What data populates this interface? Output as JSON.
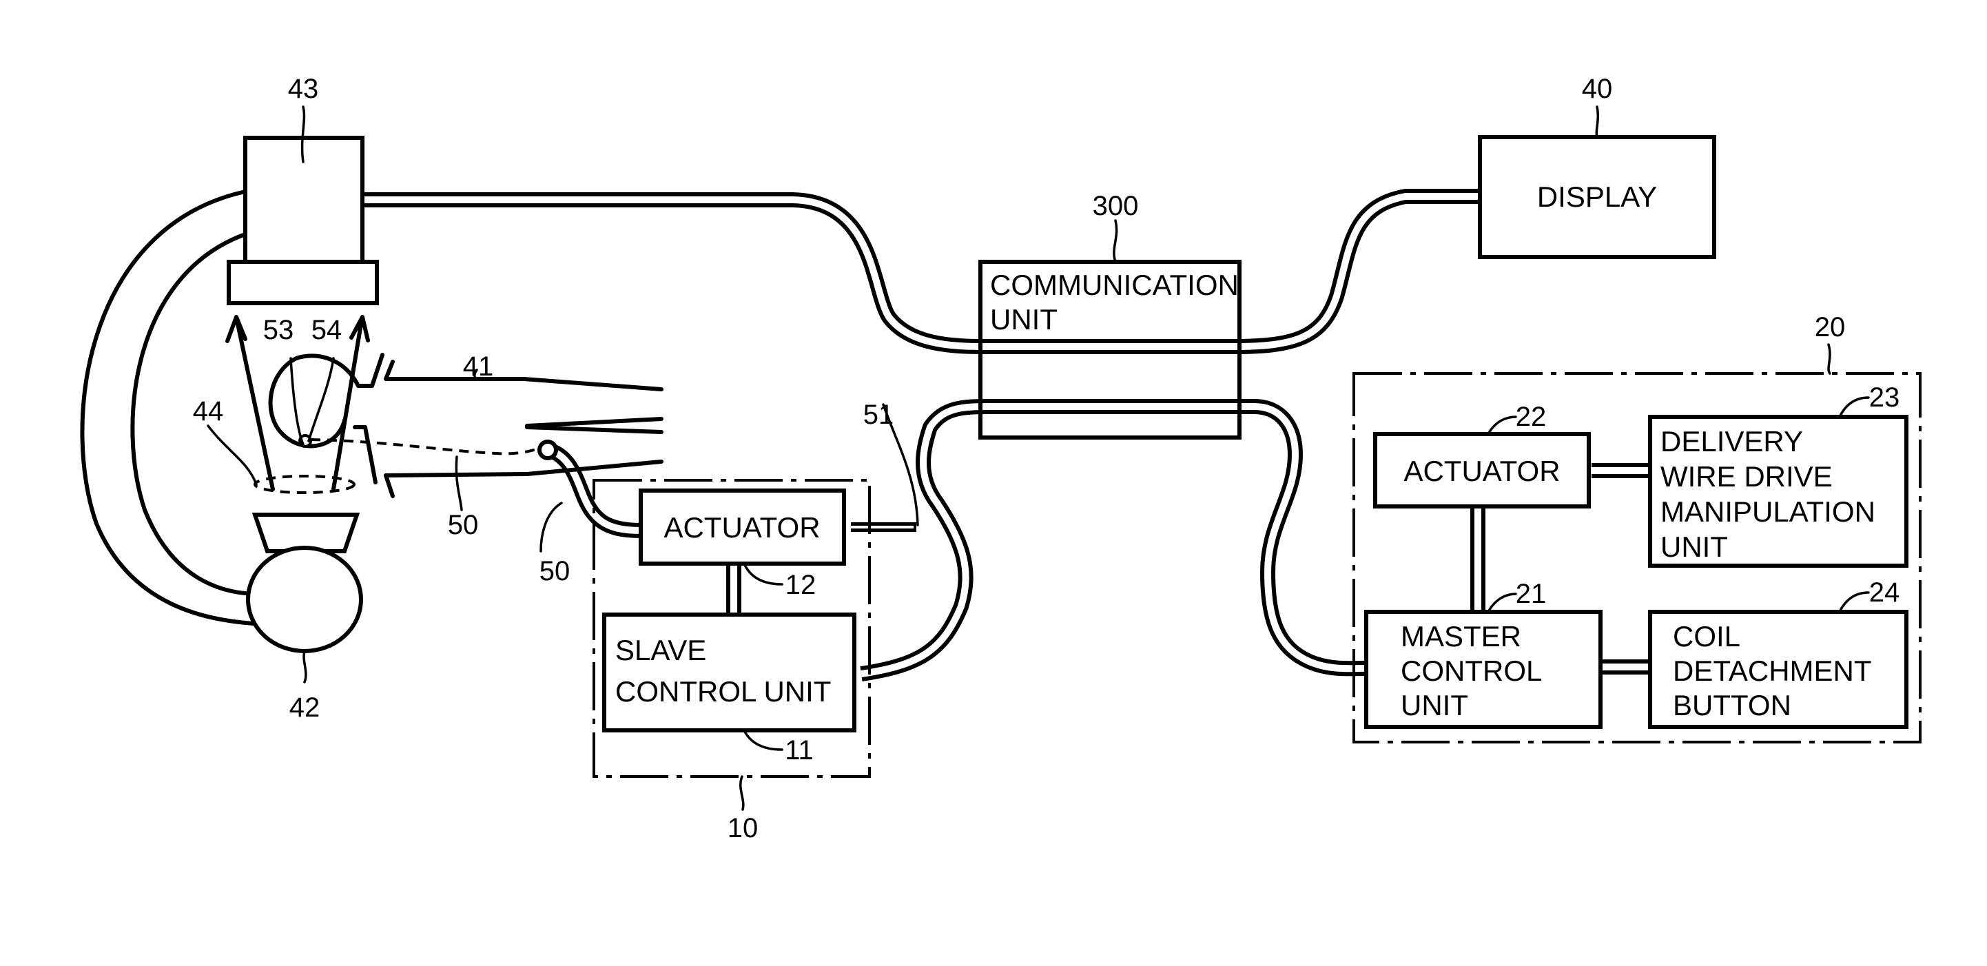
{
  "figure": {
    "type": "patent block diagram",
    "blocks": {
      "communication_unit": {
        "ref": "300",
        "lines": [
          "COMMUNICATION",
          "UNIT"
        ]
      },
      "display": {
        "ref": "40",
        "lines": [
          "DISPLAY"
        ]
      },
      "slave_group": {
        "ref": "10"
      },
      "slave_actuator": {
        "ref": "12",
        "lines": [
          "ACTUATOR"
        ]
      },
      "slave_control_unit": {
        "ref": "11",
        "lines": [
          "SLAVE",
          "CONTROL UNIT"
        ]
      },
      "master_group": {
        "ref": "20"
      },
      "master_actuator": {
        "ref": "22",
        "lines": [
          "ACTUATOR"
        ]
      },
      "delivery_wire_drive": {
        "ref": "23",
        "lines": [
          "DELIVERY",
          "WIRE DRIVE",
          "MANIPULATION",
          "UNIT"
        ]
      },
      "master_control_unit": {
        "ref": "21",
        "lines": [
          "MASTER",
          "CONTROL",
          "UNIT"
        ]
      },
      "coil_detachment_button": {
        "ref": "24",
        "lines": [
          "COIL",
          "DETACHMENT",
          "BUTTON"
        ]
      }
    },
    "refs": {
      "imaging_unit": "43",
      "xray_source": "42",
      "catheter": "41",
      "region": "44",
      "delivery_wire": "50",
      "delivery_wire_2": "50",
      "wire_51": "51",
      "aneurysm": "53",
      "coil": "54"
    }
  }
}
